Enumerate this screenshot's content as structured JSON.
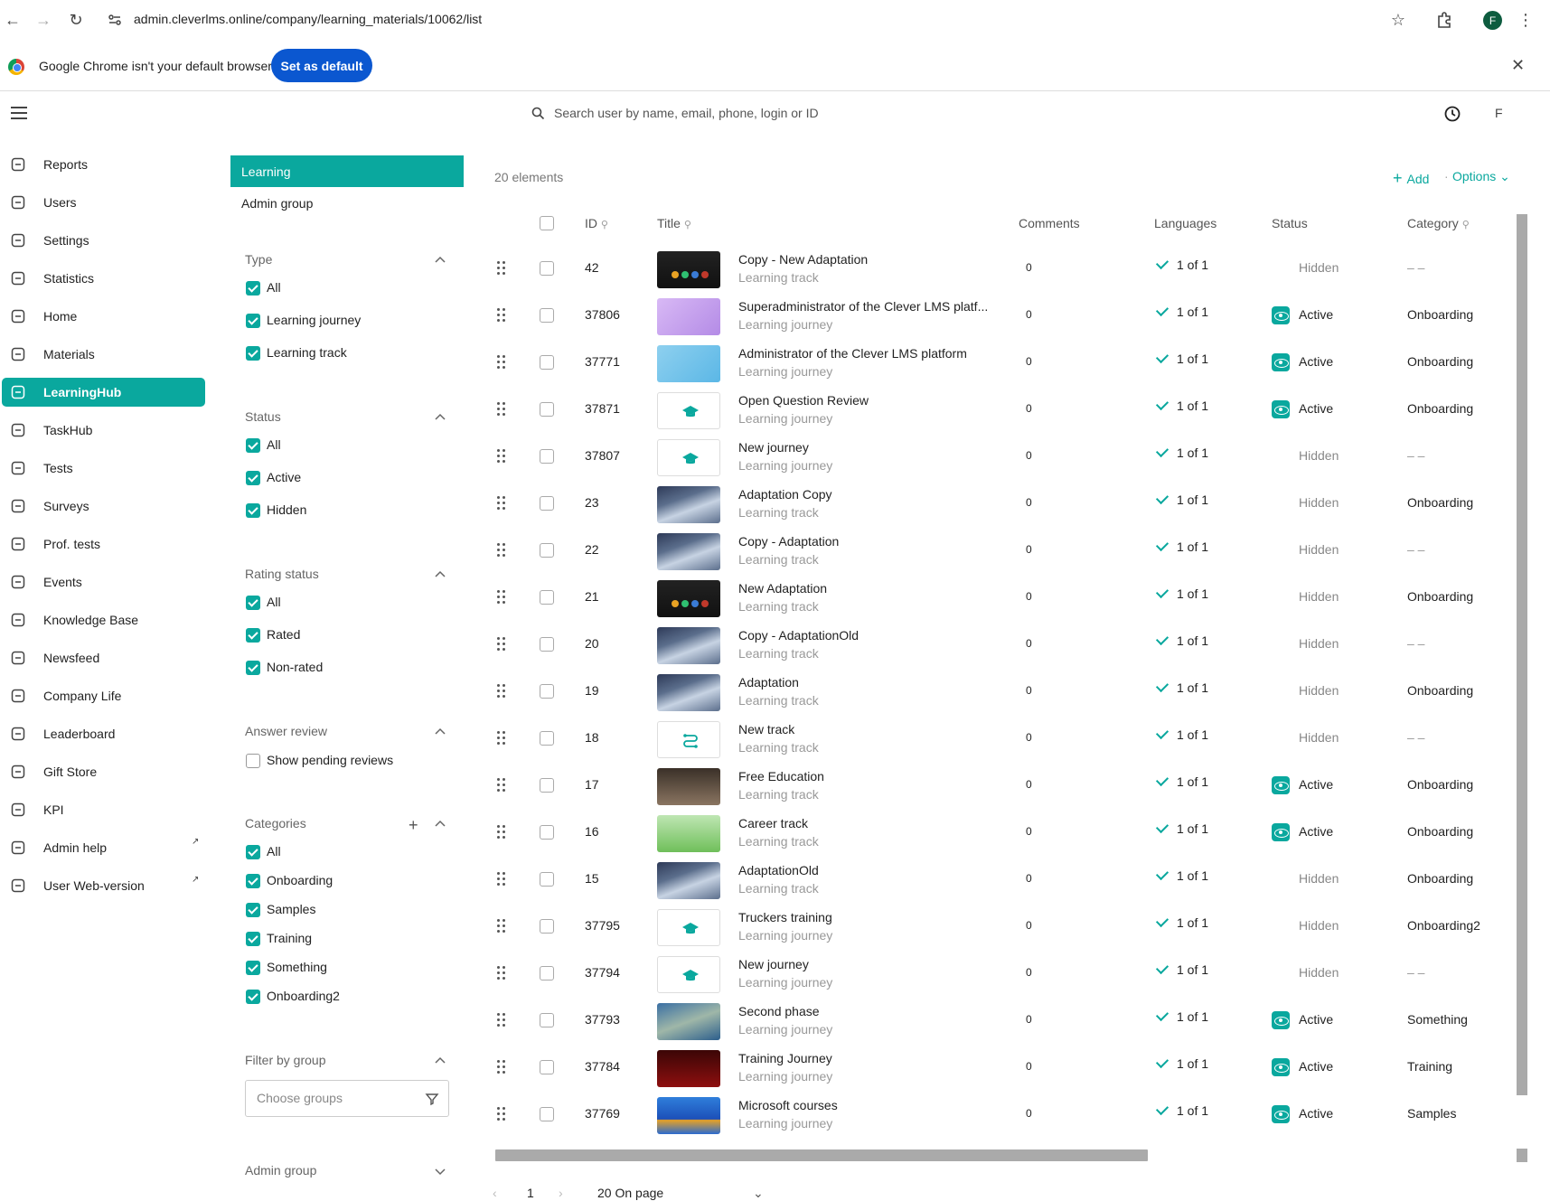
{
  "browser": {
    "url": "admin.cleverlms.online/company/learning_materials/10062/list",
    "profile_initial": "F",
    "infobar_text": "Google Chrome isn't your default browser",
    "set_default_label": "Set as default"
  },
  "header": {
    "search_placeholder": "Search user by name, email, phone, login or ID",
    "user_initial": "F"
  },
  "sidebar": {
    "items": [
      {
        "label": "Reports",
        "icon": "reports-icon"
      },
      {
        "label": "Users",
        "icon": "users-icon"
      },
      {
        "label": "Settings",
        "icon": "settings-icon"
      },
      {
        "label": "Statistics",
        "icon": "statistics-icon"
      },
      {
        "label": "Home",
        "icon": "home-icon"
      },
      {
        "label": "Materials",
        "icon": "materials-icon"
      },
      {
        "label": "LearningHub",
        "icon": "learninghub-icon",
        "active": true
      },
      {
        "label": "TaskHub",
        "icon": "taskhub-icon"
      },
      {
        "label": "Tests",
        "icon": "tests-icon"
      },
      {
        "label": "Surveys",
        "icon": "surveys-icon"
      },
      {
        "label": "Prof. tests",
        "icon": "prof-tests-icon"
      },
      {
        "label": "Events",
        "icon": "events-icon"
      },
      {
        "label": "Knowledge Base",
        "icon": "knowledge-base-icon"
      },
      {
        "label": "Newsfeed",
        "icon": "newsfeed-icon"
      },
      {
        "label": "Company Life",
        "icon": "company-life-icon"
      },
      {
        "label": "Leaderboard",
        "icon": "trophy-icon"
      },
      {
        "label": "Gift Store",
        "icon": "gift-icon"
      },
      {
        "label": "KPI",
        "icon": "kpi-icon"
      },
      {
        "label": "Admin help",
        "icon": "star-icon",
        "external": true
      },
      {
        "label": "User Web-version",
        "icon": "monitor-icon",
        "external": true
      }
    ]
  },
  "filters": {
    "tabs": {
      "learning": "Learning",
      "admin_group": "Admin group"
    },
    "type": {
      "title": "Type",
      "options": [
        "All",
        "Learning journey",
        "Learning track"
      ]
    },
    "status": {
      "title": "Status",
      "options": [
        "All",
        "Active",
        "Hidden"
      ]
    },
    "rating": {
      "title": "Rating status",
      "options": [
        "All",
        "Rated",
        "Non-rated"
      ]
    },
    "answer_review": {
      "title": "Answer review",
      "option": "Show pending reviews"
    },
    "categories": {
      "title": "Categories",
      "options": [
        "All",
        "Onboarding",
        "Samples",
        "Training",
        "Something",
        "Onboarding2"
      ]
    },
    "filter_by_group": {
      "title": "Filter by group",
      "placeholder": "Choose groups"
    },
    "admin_group": {
      "title": "Admin group"
    }
  },
  "table": {
    "count": "20 elements",
    "add_label": "Add",
    "options_label": "Options",
    "headers": {
      "id": "ID",
      "title": "Title",
      "comments": "Comments",
      "languages": "Languages",
      "status": "Status",
      "category": "Category"
    },
    "rows": [
      {
        "id": "42",
        "title": "Copy - New Adaptation",
        "type": "Learning track",
        "comments": "0",
        "languages": "1 of 1",
        "status": "Hidden",
        "category": "– –",
        "thumb": "dark"
      },
      {
        "id": "37806",
        "title": "Superadministrator of the Clever LMS platf...",
        "type": "Learning journey",
        "comments": "0",
        "languages": "1 of 1",
        "status": "Active",
        "category": "Onboarding",
        "thumb": "purple"
      },
      {
        "id": "37771",
        "title": "Administrator of the Clever LMS platform",
        "type": "Learning journey",
        "comments": "0",
        "languages": "1 of 1",
        "status": "Active",
        "category": "Onboarding",
        "thumb": "blue"
      },
      {
        "id": "37871",
        "title": "Open Question Review",
        "type": "Learning journey",
        "comments": "0",
        "languages": "1 of 1",
        "status": "Active",
        "category": "Onboarding",
        "thumb": "icon-cap"
      },
      {
        "id": "37807",
        "title": "New journey",
        "type": "Learning journey",
        "comments": "0",
        "languages": "1 of 1",
        "status": "Hidden",
        "category": "– –",
        "thumb": "icon-cap"
      },
      {
        "id": "23",
        "title": "Adaptation Copy",
        "type": "Learning track",
        "comments": "0",
        "languages": "1 of 1",
        "status": "Hidden",
        "category": "Onboarding",
        "thumb": "mount"
      },
      {
        "id": "22",
        "title": "Copy - Adaptation",
        "type": "Learning track",
        "comments": "0",
        "languages": "1 of 1",
        "status": "Hidden",
        "category": "– –",
        "thumb": "mount"
      },
      {
        "id": "21",
        "title": "New Adaptation",
        "type": "Learning track",
        "comments": "0",
        "languages": "1 of 1",
        "status": "Hidden",
        "category": "Onboarding",
        "thumb": "dark"
      },
      {
        "id": "20",
        "title": "Copy - AdaptationOld",
        "type": "Learning track",
        "comments": "0",
        "languages": "1 of 1",
        "status": "Hidden",
        "category": "– –",
        "thumb": "mount"
      },
      {
        "id": "19",
        "title": "Adaptation",
        "type": "Learning track",
        "comments": "0",
        "languages": "1 of 1",
        "status": "Hidden",
        "category": "Onboarding",
        "thumb": "mount"
      },
      {
        "id": "18",
        "title": "New track",
        "type": "Learning track",
        "comments": "0",
        "languages": "1 of 1",
        "status": "Hidden",
        "category": "– –",
        "thumb": "icon-route"
      },
      {
        "id": "17",
        "title": "Free Education",
        "type": "Learning track",
        "comments": "0",
        "languages": "1 of 1",
        "status": "Active",
        "category": "Onboarding",
        "thumb": "class"
      },
      {
        "id": "16",
        "title": "Career track",
        "type": "Learning track",
        "comments": "0",
        "languages": "1 of 1",
        "status": "Active",
        "category": "Onboarding",
        "thumb": "career"
      },
      {
        "id": "15",
        "title": "AdaptationOld",
        "type": "Learning track",
        "comments": "0",
        "languages": "1 of 1",
        "status": "Hidden",
        "category": "Onboarding",
        "thumb": "mount"
      },
      {
        "id": "37795",
        "title": "Truckers training",
        "type": "Learning journey",
        "comments": "0",
        "languages": "1 of 1",
        "status": "Hidden",
        "category": "Onboarding2",
        "thumb": "icon-cap"
      },
      {
        "id": "37794",
        "title": "New journey",
        "type": "Learning journey",
        "comments": "0",
        "languages": "1 of 1",
        "status": "Hidden",
        "category": "– –",
        "thumb": "icon-cap"
      },
      {
        "id": "37793",
        "title": "Second phase",
        "type": "Learning journey",
        "comments": "0",
        "languages": "1 of 1",
        "status": "Active",
        "category": "Something",
        "thumb": "aerial"
      },
      {
        "id": "37784",
        "title": "Training Journey",
        "type": "Learning journey",
        "comments": "0",
        "languages": "1 of 1",
        "status": "Active",
        "category": "Training",
        "thumb": "red"
      },
      {
        "id": "37769",
        "title": "Microsoft courses",
        "type": "Learning journey",
        "comments": "0",
        "languages": "1 of 1",
        "status": "Active",
        "category": "Samples",
        "thumb": "ms"
      }
    ]
  },
  "pager": {
    "page": "1",
    "per_page": "20 On page"
  },
  "colors": {
    "accent": "#0aa89e",
    "chrome_button": "#0b57d0"
  }
}
